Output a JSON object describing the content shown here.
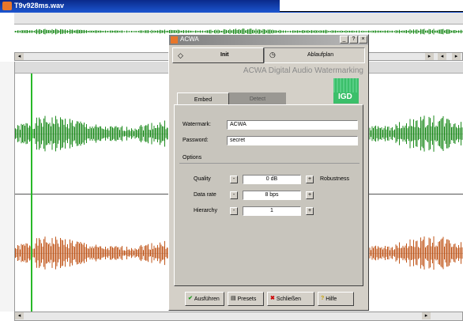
{
  "window": {
    "title": "T9v928ms.wav"
  },
  "dialog": {
    "title": "ACWA",
    "top_tabs": [
      "Init",
      "Ablaufplan"
    ],
    "brand": "ACWA Digital Audio Watermarking",
    "logo_text": "IGD",
    "tabs": [
      "Embed",
      "Detect"
    ],
    "watermark_label": "Watermark:",
    "watermark_value": "ACWA",
    "password_label": "Password:",
    "password_value": "secret",
    "options_label": "Options",
    "quality_label": "Quality",
    "quality_value": "0 dB",
    "robustness_label": "Robustness",
    "datarate_label": "Data rate",
    "datarate_value": "8 bps",
    "hierarchy_label": "Hierarchy",
    "hierarchy_value": "1",
    "buttons": {
      "run": "Ausführen",
      "presets": "Presets",
      "close": "Schließen",
      "help": "Hilfe"
    }
  },
  "colors": {
    "top_channel": "#1b8a1b",
    "bottom_channel": "#c0561a",
    "title_active": "#1c56d0"
  },
  "icons": {
    "app": "app-icon",
    "tab_init": "diamond-icon",
    "tab_plan": "clock-icon"
  }
}
